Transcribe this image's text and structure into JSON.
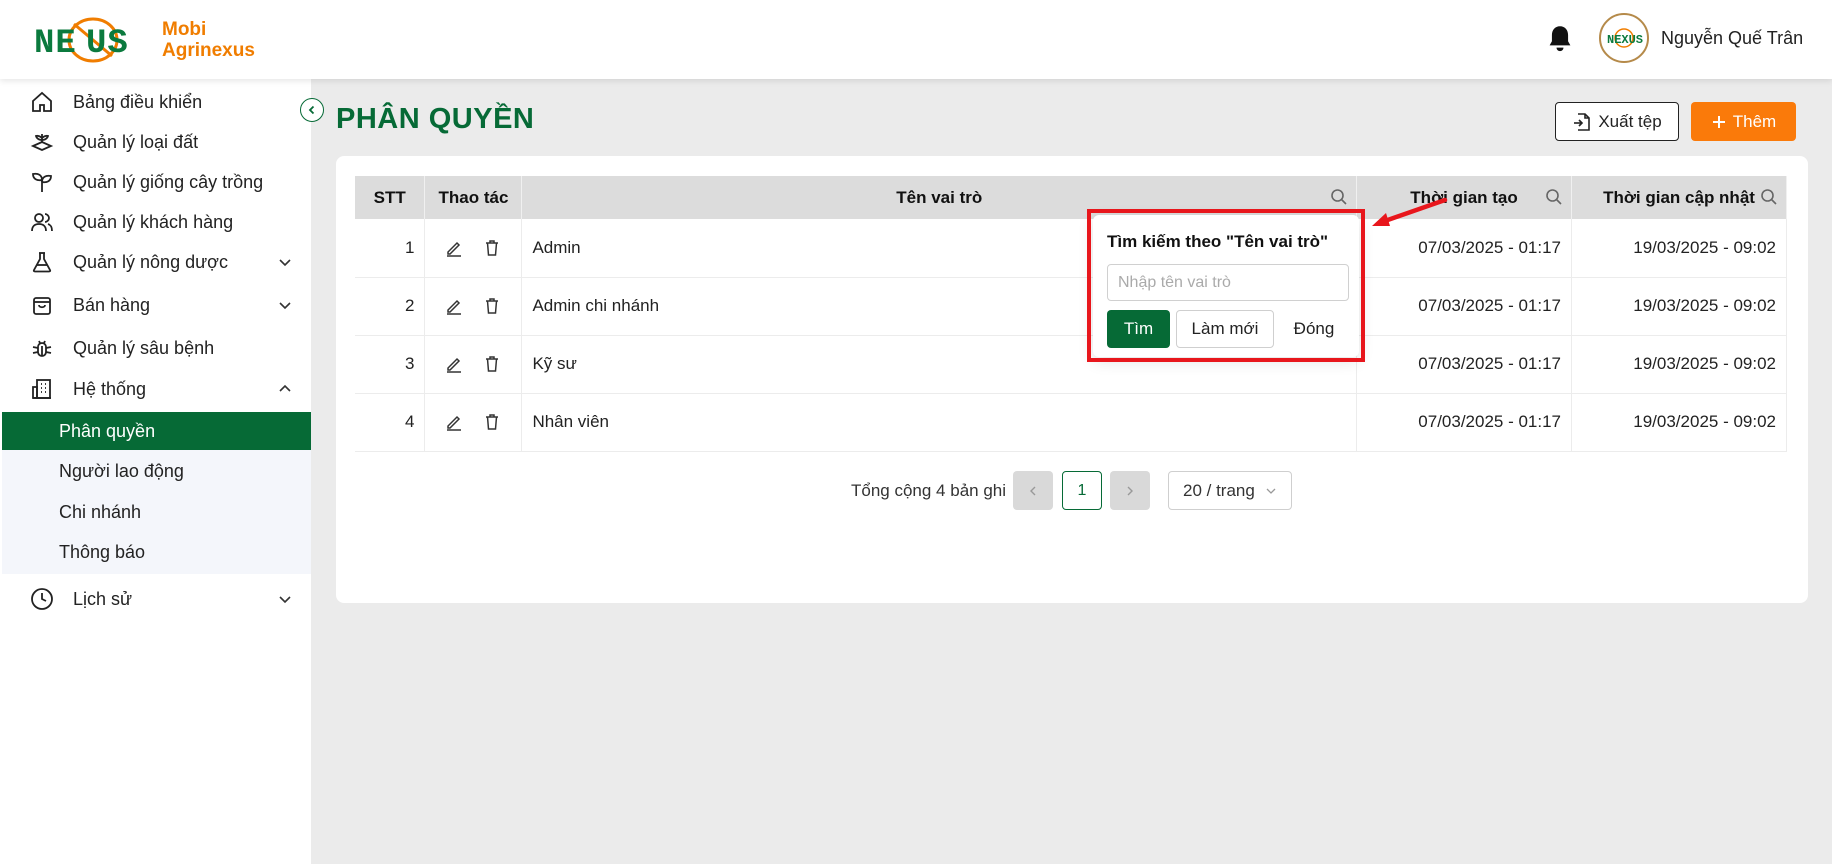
{
  "app": {
    "brand_line1": "Mobi",
    "brand_line2": "Agrinexus",
    "logo_text": "NEXUS",
    "user_name": "Nguyễn Quế Trân",
    "accent_color": "#066a36",
    "orange_color": "#fa7a0a"
  },
  "sidebar": {
    "items": [
      {
        "label": "Bảng điều khiển",
        "icon": "home-icon"
      },
      {
        "label": "Quản lý loại đất",
        "icon": "soil-icon"
      },
      {
        "label": "Quản lý giống cây trồng",
        "icon": "plant-icon"
      },
      {
        "label": "Quản lý khách hàng",
        "icon": "users-icon"
      },
      {
        "label": "Quản lý nông dược",
        "icon": "flask-icon"
      },
      {
        "label": "Bán hàng",
        "icon": "shopping-bag-icon"
      },
      {
        "label": "Quản lý sâu bệnh",
        "icon": "bug-icon"
      },
      {
        "label": "Hệ thống",
        "icon": "building-icon"
      },
      {
        "label": "Lịch sử",
        "icon": "clock-icon"
      }
    ],
    "sub_items": [
      {
        "label": "Phân quyền"
      },
      {
        "label": "Người lao động"
      },
      {
        "label": "Chi nhánh"
      },
      {
        "label": "Thông báo"
      }
    ]
  },
  "main": {
    "title": "PHÂN QUYỀN",
    "export_label": "Xuất tệp",
    "add_label": "Thêm",
    "table": {
      "headers": {
        "stt": "STT",
        "actions": "Thao tác",
        "role_name": "Tên vai trò",
        "created": "Thời gian tạo",
        "updated": "Thời gian cập nhật"
      },
      "rows": [
        {
          "stt": "1",
          "name": "Admin",
          "created": "07/03/2025 - 01:17",
          "updated": "19/03/2025 - 09:02"
        },
        {
          "stt": "2",
          "name": "Admin chi nhánh",
          "created": "07/03/2025 - 01:17",
          "updated": "19/03/2025 - 09:02"
        },
        {
          "stt": "3",
          "name": "Kỹ sư",
          "created": "07/03/2025 - 01:17",
          "updated": "19/03/2025 - 09:02"
        },
        {
          "stt": "4",
          "name": "Nhân viên",
          "created": "07/03/2025 - 01:17",
          "updated": "19/03/2025 - 09:02"
        }
      ]
    },
    "pagination": {
      "total": "Tổng cộng 4 bản ghi",
      "current_page": "1",
      "page_size": "20 / trang"
    }
  },
  "search_popover": {
    "title": "Tìm kiếm theo \"Tên vai trò\"",
    "placeholder": "Nhập tên vai trò",
    "search_label": "Tìm",
    "reset_label": "Làm mới",
    "close_label": "Đóng",
    "highlight_color": "#e8161c"
  }
}
